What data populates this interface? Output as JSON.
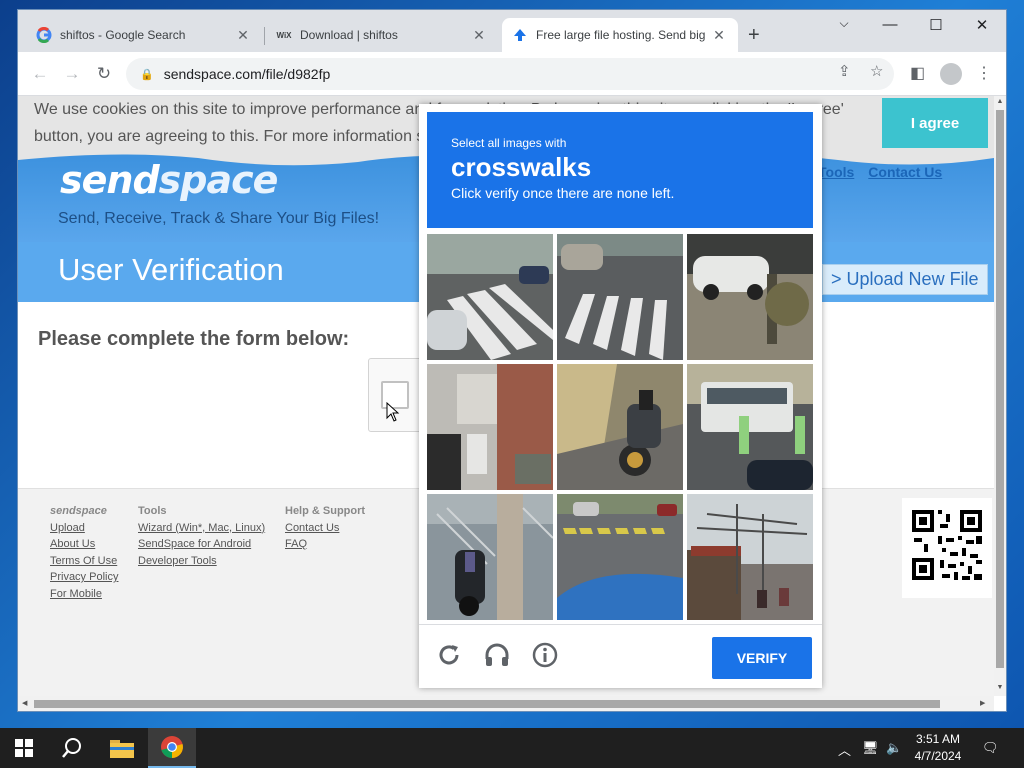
{
  "browser": {
    "tabs": [
      {
        "title": "shiftos - Google Search",
        "favicon": "google-g-icon"
      },
      {
        "title": "Download | shiftos",
        "favicon": "wix-icon",
        "favicon_text": "WiX"
      },
      {
        "title": "Free large file hosting. Send big",
        "favicon": "sendspace-arrow-icon"
      }
    ],
    "url": "sendspace.com/file/d982fp"
  },
  "page": {
    "cookie_text": "We use cookies on this site to improve performance and for analytics. By browsing this site, or clicking the 'I agree' button, you are agreeing to this. For more information s",
    "agree_label": "I agree",
    "logo": {
      "part1": "send",
      "part2": "space"
    },
    "tagline": "Send, Receive, Track & Share Your Big Files!",
    "nav": [
      "Tools",
      "Contact Us"
    ],
    "section_title": "User Verification",
    "upload_label": "> Upload New File",
    "form_heading": "Please complete the form below:",
    "footer": {
      "col1": {
        "heading": "sendspace",
        "links": [
          "Upload",
          "About Us",
          "Terms Of Use",
          "Privacy Policy",
          "For Mobile"
        ]
      },
      "col2": {
        "heading": "Tools",
        "links": [
          "Wizard (Win*, Mac, Linux)",
          "SendSpace for Android",
          "Developer Tools"
        ]
      },
      "col3": {
        "heading": "Help & Support",
        "links": [
          "Contact Us",
          "FAQ"
        ]
      }
    }
  },
  "captcha": {
    "subtitle": "Select all images with",
    "target": "crosswalks",
    "instruction": "Click verify once there are none left.",
    "verify_label": "VERIFY",
    "tiles": [
      "crosswalk-street",
      "crosswalk-road",
      "parked-car-yard",
      "building-alley",
      "motorcycle-sidewalk",
      "bus-street",
      "motorcycle-tree",
      "crosswalk-yellow",
      "street-market"
    ],
    "accent": "#1a73e8"
  },
  "taskbar": {
    "time": "3:51 AM",
    "date": "4/7/2024"
  }
}
